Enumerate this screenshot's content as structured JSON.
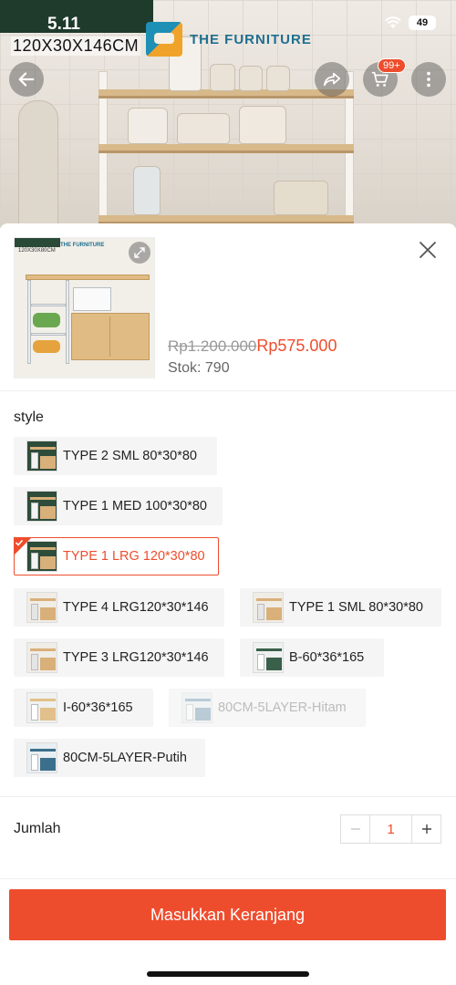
{
  "status_bar": {
    "time": "5.11",
    "battery": "49"
  },
  "hero": {
    "dimension_label": "120X30X146CM",
    "brand": "THE FURNITURE",
    "cart_badge": "99+"
  },
  "product": {
    "thumb_dims": "120X30X80CM",
    "thumb_brand": "THE FURNITURE",
    "price_original": "Rp1.200.000",
    "price_sale": "Rp575.000",
    "stock": "Stok: 790"
  },
  "variation": {
    "title": "style",
    "options": [
      {
        "label": "TYPE 2 SML 80*30*80",
        "state": "normal"
      },
      {
        "label": "TYPE 1 MED 100*30*80",
        "state": "normal"
      },
      {
        "label": "TYPE 1 LRG 120*30*80",
        "state": "selected"
      },
      {
        "label": "TYPE 4 LRG120*30*146",
        "state": "normal"
      },
      {
        "label": "TYPE 1 SML 80*30*80",
        "state": "normal"
      },
      {
        "label": "TYPE 3 LRG120*30*146",
        "state": "normal"
      },
      {
        "label": "B-60*36*165",
        "state": "normal"
      },
      {
        "label": "I-60*36*165",
        "state": "normal"
      },
      {
        "label": "80CM-5LAYER-Hitam",
        "state": "disabled"
      },
      {
        "label": "80CM-5LAYER-Putih",
        "state": "normal"
      }
    ]
  },
  "quantity": {
    "label": "Jumlah",
    "value": "1"
  },
  "cta": {
    "label": "Masukkan Keranjang"
  },
  "colors": {
    "accent": "#ee4d2d",
    "option_bg": "#f5f5f5"
  }
}
